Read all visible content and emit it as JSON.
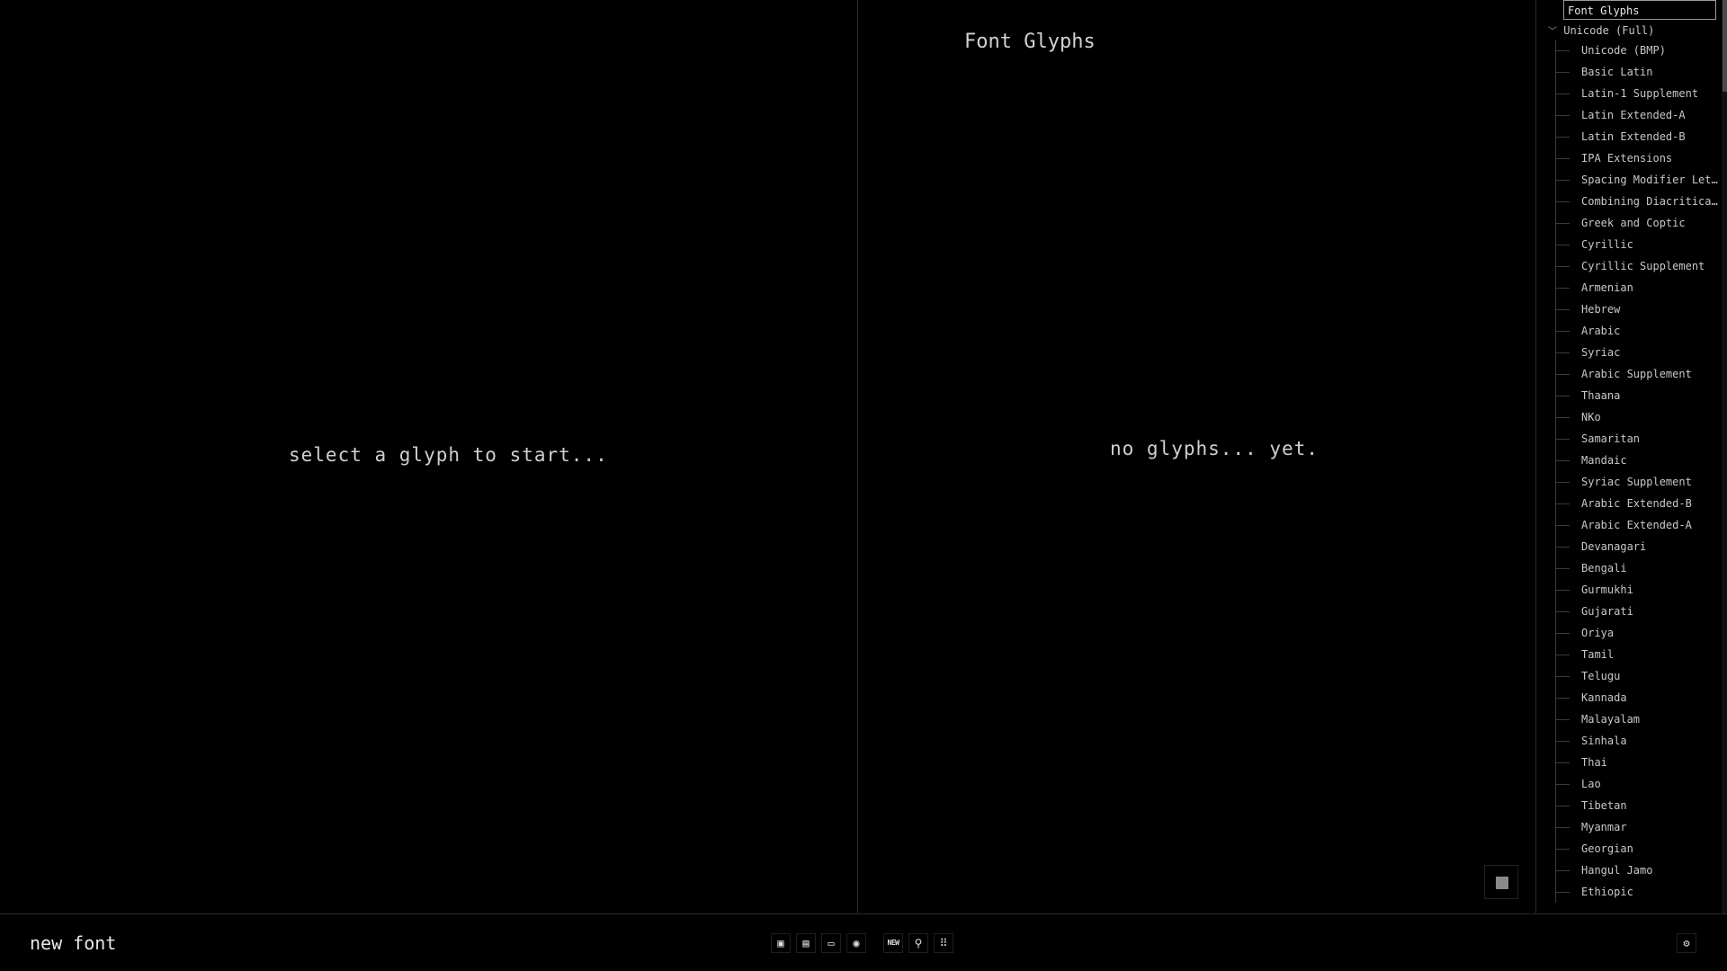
{
  "editor": {
    "hint": "select a glyph to start..."
  },
  "glyphs": {
    "title": "Font Glyphs",
    "empty_message": "no glyphs... yet."
  },
  "sidebar": {
    "title": "Font Glyphs",
    "root": {
      "label": "Unicode (Full)",
      "expanded": true
    },
    "items": [
      "Unicode (BMP)",
      "Basic Latin",
      "Latin-1 Supplement",
      "Latin Extended-A",
      "Latin Extended-B",
      "IPA Extensions",
      "Spacing Modifier Letters",
      "Combining Diacritical Ma…",
      "Greek and Coptic",
      "Cyrillic",
      "Cyrillic Supplement",
      "Armenian",
      "Hebrew",
      "Arabic",
      "Syriac",
      "Arabic Supplement",
      "Thaana",
      "NKo",
      "Samaritan",
      "Mandaic",
      "Syriac Supplement",
      "Arabic Extended-B",
      "Arabic Extended-A",
      "Devanagari",
      "Bengali",
      "Gurmukhi",
      "Gujarati",
      "Oriya",
      "Tamil",
      "Telugu",
      "Kannada",
      "Malayalam",
      "Sinhala",
      "Thai",
      "Lao",
      "Tibetan",
      "Myanmar",
      "Georgian",
      "Hangul Jamo",
      "Ethiopic"
    ]
  },
  "bottombar": {
    "font_name": "new font",
    "tools": [
      {
        "name": "import-tool-icon",
        "glyph": "▣"
      },
      {
        "name": "save-icon",
        "glyph": "▤"
      },
      {
        "name": "folder-open-icon",
        "glyph": "▭"
      },
      {
        "name": "eye-icon",
        "glyph": "◉"
      },
      {
        "name": "new-icon",
        "glyph": "NEW"
      },
      {
        "name": "search-icon",
        "glyph": "⚲"
      },
      {
        "name": "grid-icon",
        "glyph": "⠿"
      }
    ],
    "settings_icon": "⚙"
  },
  "colors": {
    "background": "#000000",
    "text": "#d8d8d8",
    "divider": "#2a2a2a",
    "stop_square": "#8a8a8a"
  }
}
